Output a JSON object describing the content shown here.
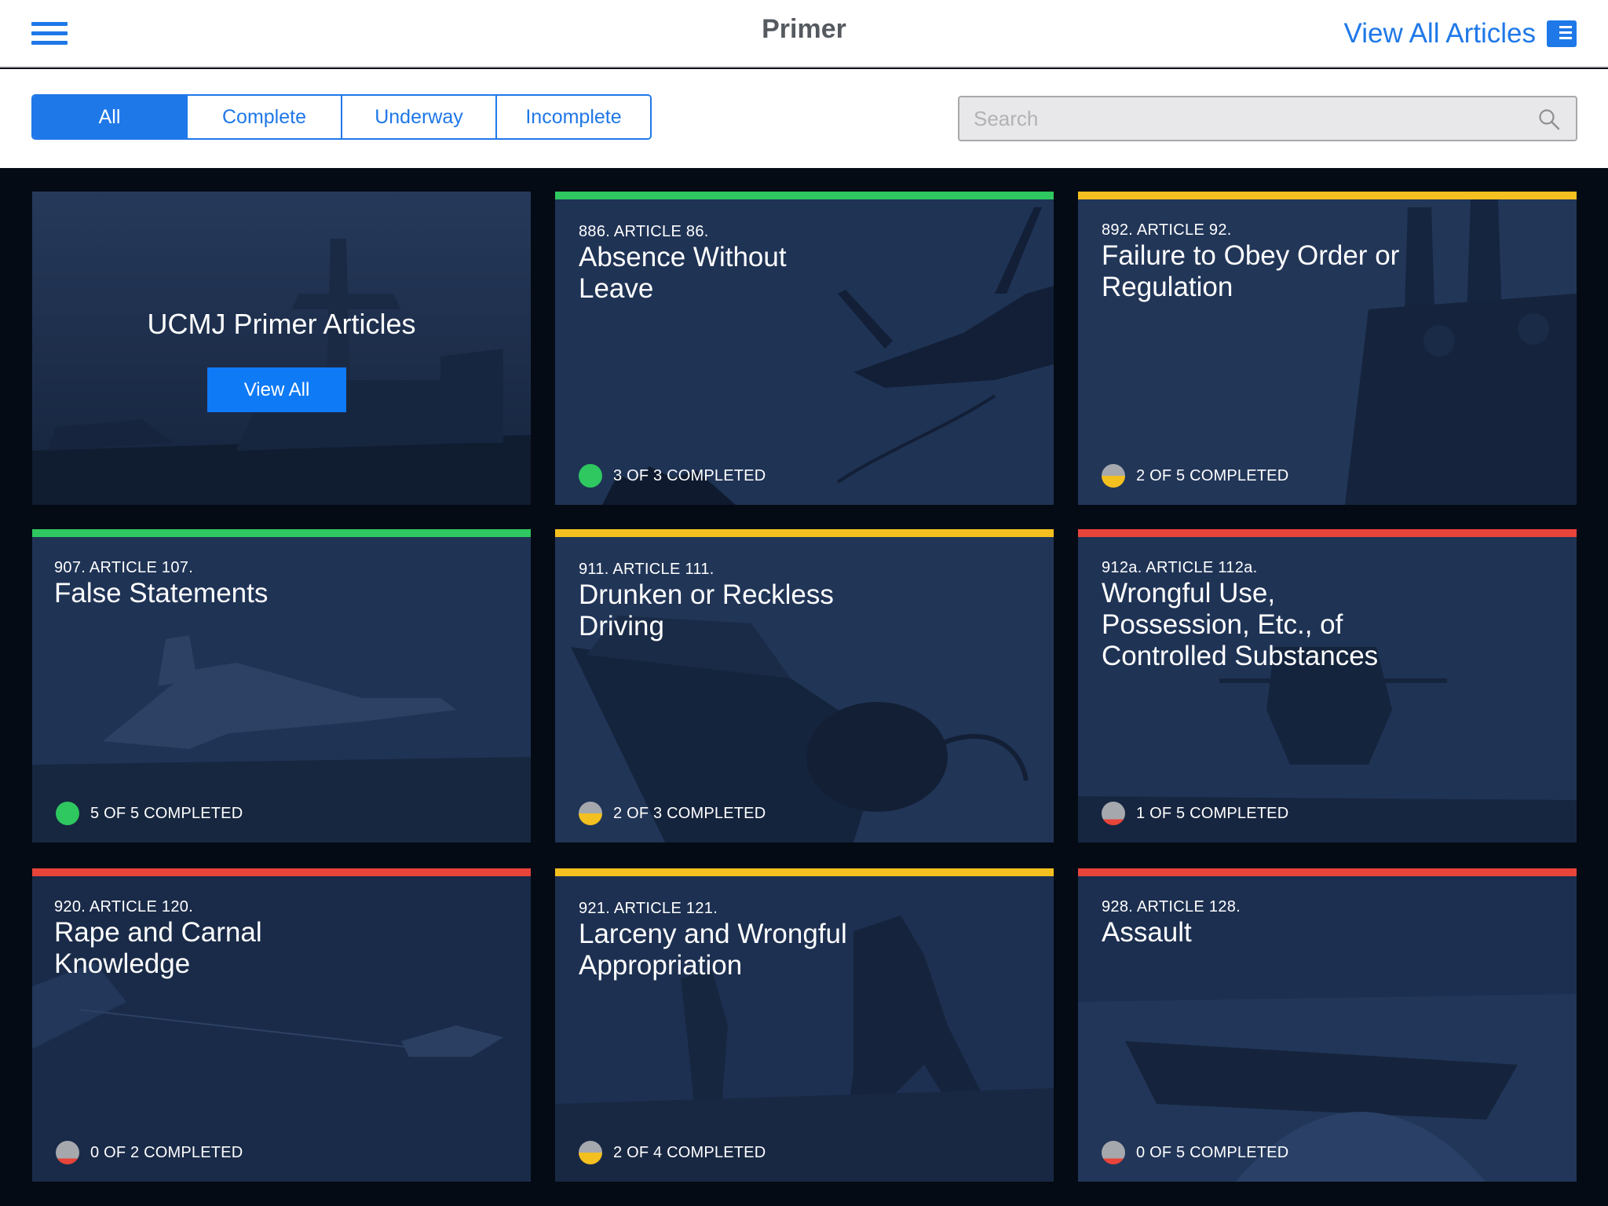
{
  "header": {
    "title": "Primer",
    "view_all_articles": "View All Articles",
    "menu_icon": "hamburger-menu-icon",
    "articles_icon": "reader-icon"
  },
  "filters": {
    "tabs": [
      {
        "label": "All",
        "active": true
      },
      {
        "label": "Complete",
        "active": false
      },
      {
        "label": "Underway",
        "active": false
      },
      {
        "label": "Incomplete",
        "active": false
      }
    ]
  },
  "search": {
    "placeholder": "Search",
    "value": "",
    "icon": "search-icon"
  },
  "hero": {
    "title": "UCMJ Primer Articles",
    "button": "View All"
  },
  "colors": {
    "accent": "#1f78e8",
    "complete": "#2ec760",
    "underway": "#f4c020",
    "incomplete": "#e8443a",
    "grey": "#a5a8ad"
  },
  "articles": [
    {
      "number": "886. ARTICLE 86.",
      "title": "Absence Without Leave",
      "progress": "3 OF 3 COMPLETED",
      "status": "complete"
    },
    {
      "number": "892. ARTICLE 92.",
      "title": "Failure to Obey Order or Regulation",
      "progress": "2 OF 5 COMPLETED",
      "status": "underway"
    },
    {
      "number": "907. ARTICLE 107.",
      "title": "False Statements",
      "progress": "5 OF 5 COMPLETED",
      "status": "complete"
    },
    {
      "number": "911. ARTICLE 111.",
      "title": "Drunken or Reckless Driving",
      "progress": "2 OF 3 COMPLETED",
      "status": "underway"
    },
    {
      "number": "912a. ARTICLE 112a.",
      "title": "Wrongful Use, Possession, Etc., of Controlled Substances",
      "progress": "1 OF 5 COMPLETED",
      "status": "incomplete"
    },
    {
      "number": "920. ARTICLE 120.",
      "title": "Rape and Carnal Knowledge",
      "progress": "0 OF 2 COMPLETED",
      "status": "incomplete"
    },
    {
      "number": "921. ARTICLE 121.",
      "title": "Larceny and Wrongful Appropriation",
      "progress": "2 OF 4 COMPLETED",
      "status": "underway"
    },
    {
      "number": "928. ARTICLE 128.",
      "title": "Assault",
      "progress": "0 OF 5 COMPLETED",
      "status": "incomplete"
    }
  ]
}
